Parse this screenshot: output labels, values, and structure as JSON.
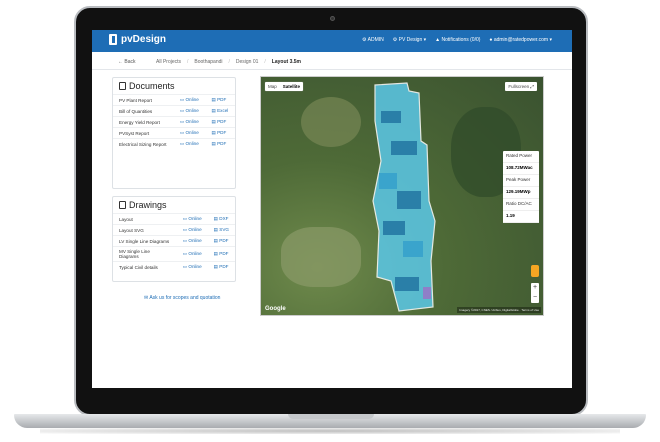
{
  "app": {
    "brand": "pvDesign"
  },
  "navbar": {
    "admin": "ADMIN",
    "pvdesign": "PV Design ▾",
    "notifications": "Notifications (0/0)",
    "user": "admin@ratedpower.com ▾"
  },
  "breadcrumb": {
    "back": "← Back",
    "items": [
      "All Projects",
      "Boothapandi",
      "Design 01",
      "Layout 3.5m"
    ]
  },
  "documents": {
    "title": "Documents",
    "rows": [
      {
        "name": "PV Plant Report",
        "online": "Online",
        "file": "PDF"
      },
      {
        "name": "Bill of Quantities",
        "online": "Online",
        "file": "Excel"
      },
      {
        "name": "Energy Yield Report",
        "online": "Online",
        "file": "PDF"
      },
      {
        "name": "PVSyst Report",
        "online": "Online",
        "file": "PDF"
      },
      {
        "name": "Electrical Sizing Report",
        "online": "Online",
        "file": "PDF"
      }
    ]
  },
  "drawings": {
    "title": "Drawings",
    "rows": [
      {
        "name": "Layout",
        "online": "Online",
        "file": "DXF"
      },
      {
        "name": "Layout SVG",
        "online": "Online",
        "file": "SVG"
      },
      {
        "name": "LV Single Line Diagrams",
        "online": "Online",
        "file": "PDF"
      },
      {
        "name": "MV Single Line Diagrams",
        "online": "Online",
        "file": "PDF"
      },
      {
        "name": "Typical Civil details",
        "online": "Online",
        "file": "PDF"
      }
    ]
  },
  "quote_link": "Ask us for scopes and quotation",
  "map": {
    "type_map": "Map",
    "type_satellite": "Satellite",
    "fullscreen": "Fullscreen",
    "rated_power_label": "Rated Power",
    "rated_power_value": "108.72MWac",
    "peak_power_label": "Peak Power",
    "peak_power_value": "129.19MWp",
    "ratio_label": "Ratio DC/AC",
    "ratio_value": "1.19",
    "google": "Google",
    "attribution": "Imagery ©2017, CNES / Airbus, DigitalGlobe · Terms of Use",
    "colors": {
      "block_light": "#5bc8e8",
      "block_dark": "#2a7fa8",
      "block_mid": "#3aa4cc"
    }
  }
}
